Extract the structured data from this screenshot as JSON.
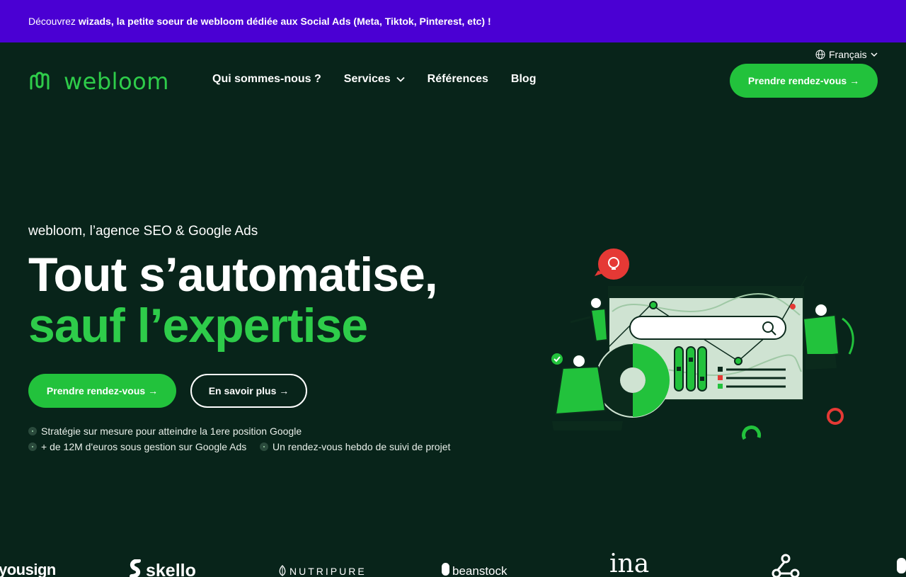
{
  "banner": {
    "lead": "Découvrez",
    "strong": "wizads, la petite soeur de webloom dédiée aux Social Ads (Meta, Tiktok, Pinterest, etc) !"
  },
  "header": {
    "language": "Français",
    "logo_text": "webloom",
    "nav": [
      "Qui sommes-nous ?",
      "Services",
      "Références",
      "Blog"
    ],
    "cta": "Prendre rendez-vous →"
  },
  "hero": {
    "eyebrow": "webloom, l’agence SEO & Google Ads",
    "title_line1": "Tout s’automatise,",
    "title_line2": "sauf l’expertise",
    "primary_button": "Prendre rendez-vous →",
    "secondary_button": "En savoir plus →",
    "features": [
      "Stratégie sur mesure pour atteindre la 1ere position Google",
      "+ de 12M d'euros sous gestion sur Google Ads",
      "Un rendez-vous hebdo de suivi de projet"
    ]
  },
  "client_logos": [
    "yousign",
    "skello",
    "NUTRIPURE",
    "beanstock",
    "ina"
  ],
  "colors": {
    "background": "#08241a",
    "banner": "#4a00d3",
    "accent_green": "#22c23c",
    "illustration_red": "#e53935"
  },
  "icons": [
    "globe-icon",
    "chevron-down-icon",
    "webloom-logo-icon",
    "search-icon",
    "lightbulb-icon"
  ]
}
